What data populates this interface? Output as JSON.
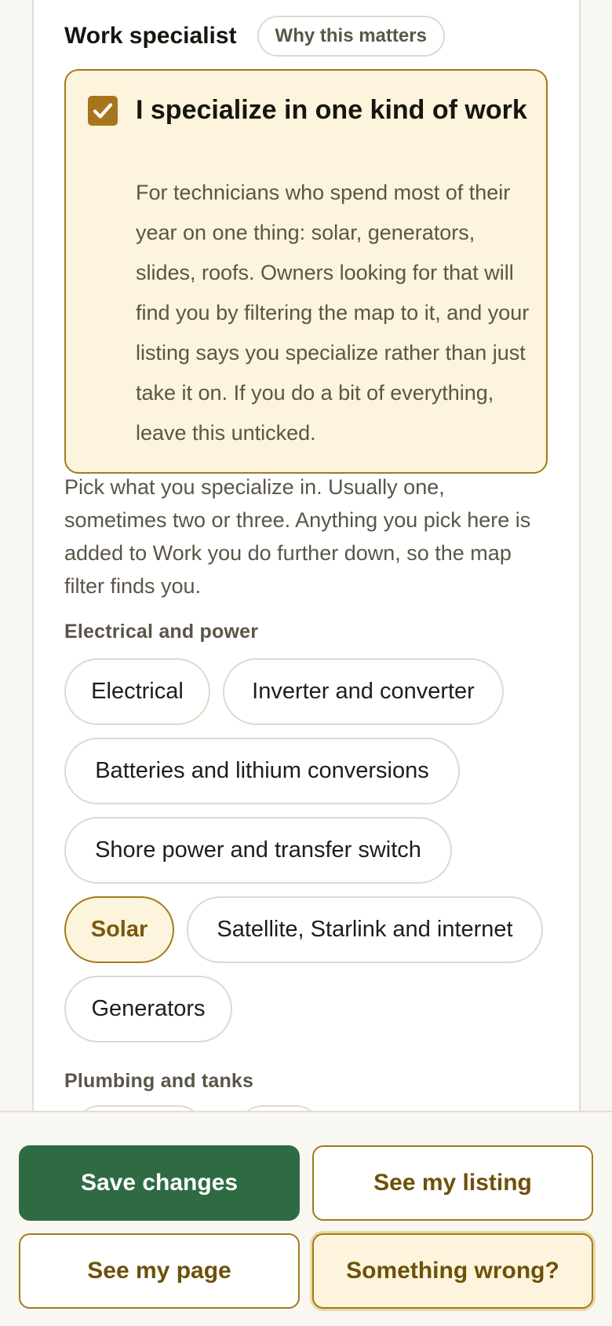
{
  "section": {
    "title": "Work specialist",
    "why_label": "Why this matters"
  },
  "specialist_card": {
    "checked": true,
    "title": "I specialize in one kind of work",
    "description": "For technicians who spend most of their year on one thing: solar, generators, slides, roofs. Owners looking for that will find you by filtering the map to it, and your listing says you specialize rather than just take it on. If you do a bit of everything, leave this unticked."
  },
  "intro": "Pick what you specialize in. Usually one, sometimes two or three. Anything you pick here is added to Work you do further down, so the map filter finds you.",
  "groups": [
    {
      "label": "Electrical and power",
      "chips": [
        {
          "label": "Electrical",
          "selected": false
        },
        {
          "label": "Inverter and converter",
          "selected": false
        },
        {
          "label": "Batteries and lithium conversions",
          "selected": false
        },
        {
          "label": "Shore power and transfer switch",
          "selected": false
        },
        {
          "label": "Solar",
          "selected": true
        },
        {
          "label": "Satellite, Starlink and internet",
          "selected": false
        },
        {
          "label": "Generators",
          "selected": false
        }
      ]
    },
    {
      "label": "Plumbing and tanks"
    }
  ],
  "footer": {
    "save": "Save changes",
    "see_listing": "See my listing",
    "see_page": "See my page",
    "report": "Something wrong?"
  },
  "colors": {
    "accent_gold": "#a47b1c",
    "selected_bg": "#fcf4dc",
    "primary_green": "#2e6b43"
  }
}
